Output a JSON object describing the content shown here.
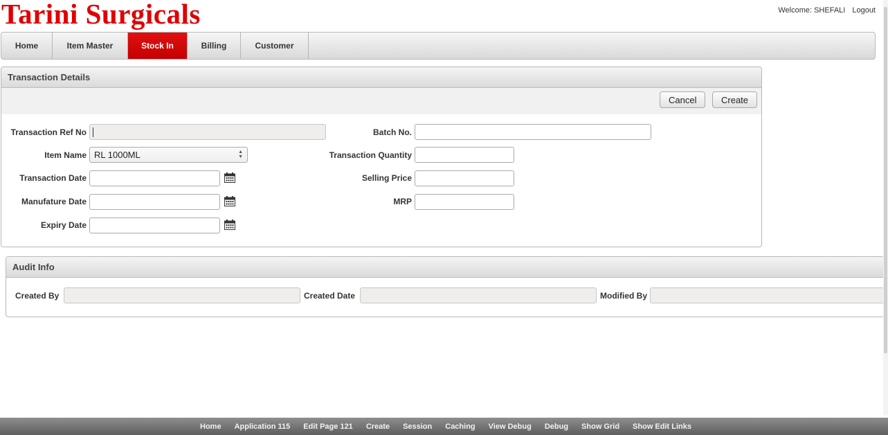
{
  "app": {
    "title": "Tarini Surgicals",
    "welcome": "Welcome: SHEFALI",
    "logout": "Logout",
    "accent": "#e00000"
  },
  "tabs": [
    {
      "label": "Home",
      "active": false
    },
    {
      "label": "Item Master",
      "active": false
    },
    {
      "label": "Stock In",
      "active": true
    },
    {
      "label": "Billing",
      "active": false
    },
    {
      "label": "Customer",
      "active": false
    }
  ],
  "transaction": {
    "title": "Transaction Details",
    "cancel_label": "Cancel",
    "create_label": "Create",
    "fields": {
      "ref_no": {
        "label": "Transaction Ref No",
        "value": ""
      },
      "item_name": {
        "label": "Item Name",
        "value": "RL 1000ML"
      },
      "transaction_date": {
        "label": "Transaction Date",
        "value": ""
      },
      "manufature_date": {
        "label": "Manufature Date",
        "value": ""
      },
      "expiry_date": {
        "label": "Expiry Date",
        "value": ""
      },
      "batch_no": {
        "label": "Batch No.",
        "value": ""
      },
      "quantity": {
        "label": "Transaction Quantity",
        "value": ""
      },
      "selling_price": {
        "label": "Selling Price",
        "value": ""
      },
      "mrp": {
        "label": "MRP",
        "value": ""
      }
    }
  },
  "audit": {
    "title": "Audit Info",
    "created_by": {
      "label": "Created By",
      "value": ""
    },
    "created_date": {
      "label": "Created Date",
      "value": ""
    },
    "modified_by": {
      "label": "Modified By",
      "value": ""
    }
  },
  "devbar": [
    "Home",
    "Application 115",
    "Edit Page 121",
    "Create",
    "Session",
    "Caching",
    "View Debug",
    "Debug",
    "Show Grid",
    "Show Edit Links"
  ],
  "icons": {
    "calendar": "calendar-icon",
    "select_arrows": "up-down-arrows-icon"
  }
}
